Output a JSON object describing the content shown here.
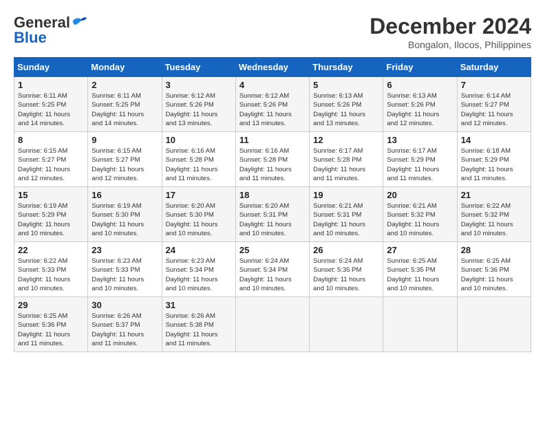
{
  "logo": {
    "general": "General",
    "blue": "Blue"
  },
  "header": {
    "month": "December 2024",
    "location": "Bongalon, Ilocos, Philippines"
  },
  "weekdays": [
    "Sunday",
    "Monday",
    "Tuesday",
    "Wednesday",
    "Thursday",
    "Friday",
    "Saturday"
  ],
  "weeks": [
    [
      {
        "day": "1",
        "sunrise": "6:11 AM",
        "sunset": "5:25 PM",
        "daylight": "11 hours and 14 minutes."
      },
      {
        "day": "2",
        "sunrise": "6:11 AM",
        "sunset": "5:25 PM",
        "daylight": "11 hours and 14 minutes."
      },
      {
        "day": "3",
        "sunrise": "6:12 AM",
        "sunset": "5:26 PM",
        "daylight": "11 hours and 13 minutes."
      },
      {
        "day": "4",
        "sunrise": "6:12 AM",
        "sunset": "5:26 PM",
        "daylight": "11 hours and 13 minutes."
      },
      {
        "day": "5",
        "sunrise": "6:13 AM",
        "sunset": "5:26 PM",
        "daylight": "11 hours and 13 minutes."
      },
      {
        "day": "6",
        "sunrise": "6:13 AM",
        "sunset": "5:26 PM",
        "daylight": "11 hours and 12 minutes."
      },
      {
        "day": "7",
        "sunrise": "6:14 AM",
        "sunset": "5:27 PM",
        "daylight": "11 hours and 12 minutes."
      }
    ],
    [
      {
        "day": "8",
        "sunrise": "6:15 AM",
        "sunset": "5:27 PM",
        "daylight": "11 hours and 12 minutes."
      },
      {
        "day": "9",
        "sunrise": "6:15 AM",
        "sunset": "5:27 PM",
        "daylight": "11 hours and 12 minutes."
      },
      {
        "day": "10",
        "sunrise": "6:16 AM",
        "sunset": "5:28 PM",
        "daylight": "11 hours and 11 minutes."
      },
      {
        "day": "11",
        "sunrise": "6:16 AM",
        "sunset": "5:28 PM",
        "daylight": "11 hours and 11 minutes."
      },
      {
        "day": "12",
        "sunrise": "6:17 AM",
        "sunset": "5:28 PM",
        "daylight": "11 hours and 11 minutes."
      },
      {
        "day": "13",
        "sunrise": "6:17 AM",
        "sunset": "5:29 PM",
        "daylight": "11 hours and 11 minutes."
      },
      {
        "day": "14",
        "sunrise": "6:18 AM",
        "sunset": "5:29 PM",
        "daylight": "11 hours and 11 minutes."
      }
    ],
    [
      {
        "day": "15",
        "sunrise": "6:19 AM",
        "sunset": "5:29 PM",
        "daylight": "11 hours and 10 minutes."
      },
      {
        "day": "16",
        "sunrise": "6:19 AM",
        "sunset": "5:30 PM",
        "daylight": "11 hours and 10 minutes."
      },
      {
        "day": "17",
        "sunrise": "6:20 AM",
        "sunset": "5:30 PM",
        "daylight": "11 hours and 10 minutes."
      },
      {
        "day": "18",
        "sunrise": "6:20 AM",
        "sunset": "5:31 PM",
        "daylight": "11 hours and 10 minutes."
      },
      {
        "day": "19",
        "sunrise": "6:21 AM",
        "sunset": "5:31 PM",
        "daylight": "11 hours and 10 minutes."
      },
      {
        "day": "20",
        "sunrise": "6:21 AM",
        "sunset": "5:32 PM",
        "daylight": "11 hours and 10 minutes."
      },
      {
        "day": "21",
        "sunrise": "6:22 AM",
        "sunset": "5:32 PM",
        "daylight": "11 hours and 10 minutes."
      }
    ],
    [
      {
        "day": "22",
        "sunrise": "6:22 AM",
        "sunset": "5:33 PM",
        "daylight": "11 hours and 10 minutes."
      },
      {
        "day": "23",
        "sunrise": "6:23 AM",
        "sunset": "5:33 PM",
        "daylight": "11 hours and 10 minutes."
      },
      {
        "day": "24",
        "sunrise": "6:23 AM",
        "sunset": "5:34 PM",
        "daylight": "11 hours and 10 minutes."
      },
      {
        "day": "25",
        "sunrise": "6:24 AM",
        "sunset": "5:34 PM",
        "daylight": "11 hours and 10 minutes."
      },
      {
        "day": "26",
        "sunrise": "6:24 AM",
        "sunset": "5:35 PM",
        "daylight": "11 hours and 10 minutes."
      },
      {
        "day": "27",
        "sunrise": "6:25 AM",
        "sunset": "5:35 PM",
        "daylight": "11 hours and 10 minutes."
      },
      {
        "day": "28",
        "sunrise": "6:25 AM",
        "sunset": "5:36 PM",
        "daylight": "11 hours and 10 minutes."
      }
    ],
    [
      {
        "day": "29",
        "sunrise": "6:25 AM",
        "sunset": "5:36 PM",
        "daylight": "11 hours and 11 minutes."
      },
      {
        "day": "30",
        "sunrise": "6:26 AM",
        "sunset": "5:37 PM",
        "daylight": "11 hours and 11 minutes."
      },
      {
        "day": "31",
        "sunrise": "6:26 AM",
        "sunset": "5:38 PM",
        "daylight": "11 hours and 11 minutes."
      },
      null,
      null,
      null,
      null
    ]
  ]
}
